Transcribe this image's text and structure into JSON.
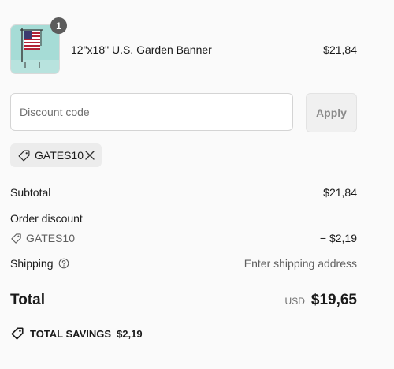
{
  "cart": {
    "items": [
      {
        "quantity": "1",
        "name": "12\"x18\" U.S. Garden Banner",
        "price": "$21,84"
      }
    ]
  },
  "discount": {
    "placeholder": "Discount code",
    "value": "",
    "apply_label": "Apply",
    "applied_code": "GATES10"
  },
  "summary": {
    "subtotal_label": "Subtotal",
    "subtotal_value": "$21,84",
    "order_discount_label": "Order discount",
    "discount_code": "GATES10",
    "discount_value": "− $2,19",
    "shipping_label": "Shipping",
    "shipping_value": "Enter shipping address",
    "total_label": "Total",
    "currency": "USD",
    "total_value": "$19,65",
    "savings_label": "TOTAL SAVINGS",
    "savings_value": "$2,19"
  },
  "icons": {
    "tag": "tag-icon",
    "remove": "close-icon",
    "help": "question-circle-icon",
    "savings": "tag-icon"
  }
}
